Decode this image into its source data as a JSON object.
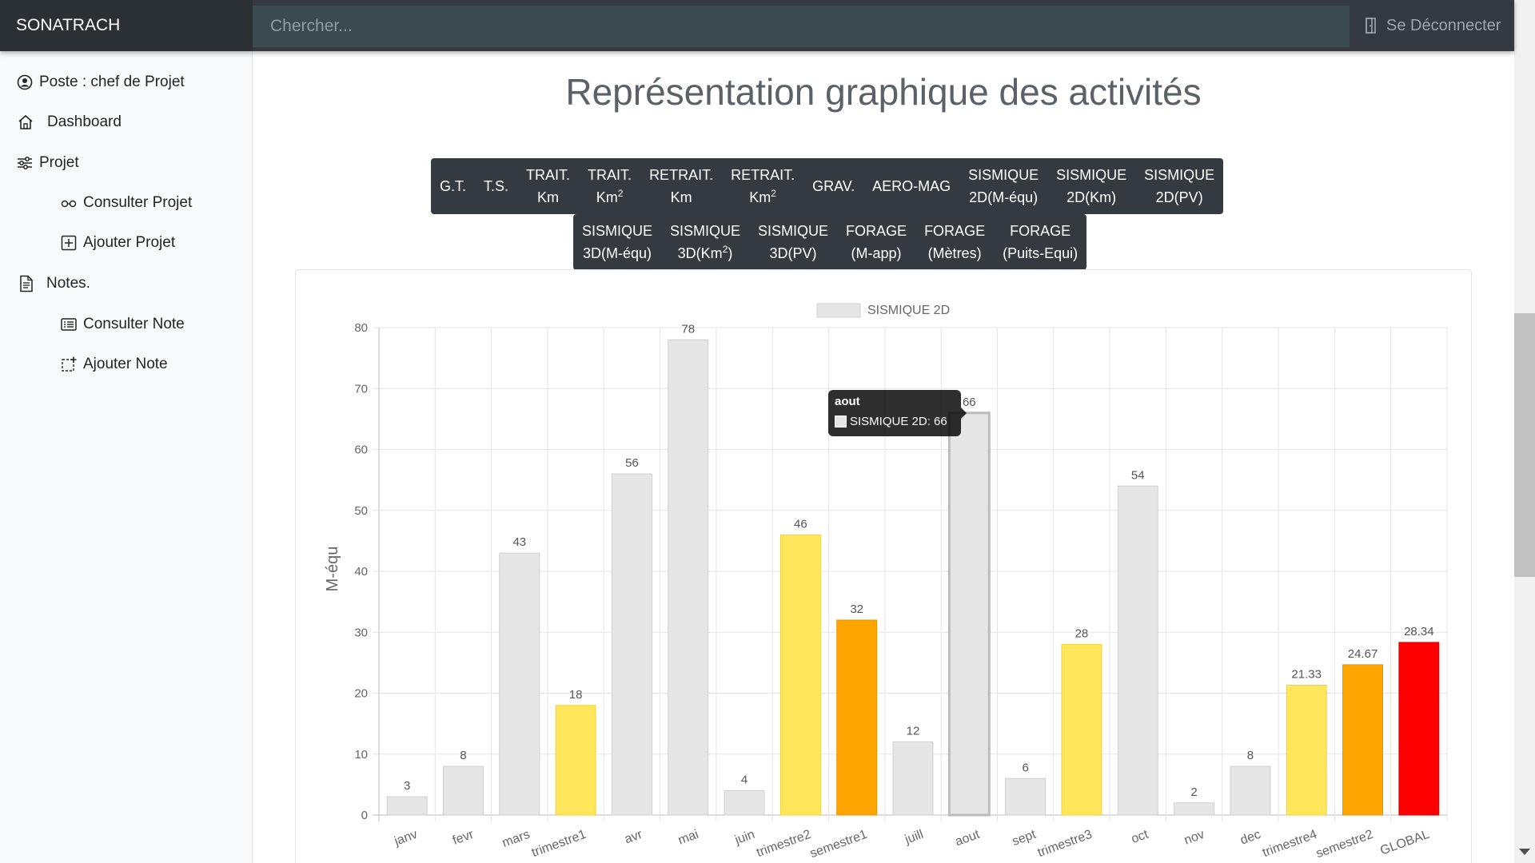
{
  "topbar": {
    "brand": "SONATRACH",
    "search_placeholder": "Chercher...",
    "logout_label": "Se Déconnecter"
  },
  "sidebar": {
    "poste": "Poste : chef de Projet",
    "dashboard": "Dashboard",
    "projet": "Projet",
    "consulter_projet": "Consulter Projet",
    "ajouter_projet": "Ajouter Projet",
    "notes": "Notes.",
    "consulter_note": "Consulter Note",
    "ajouter_note": "Ajouter Note"
  },
  "page": {
    "title": "Représentation graphique des activités"
  },
  "activity_buttons_row1": [
    {
      "l1": "G.T.",
      "l2": ""
    },
    {
      "l1": "T.S.",
      "l2": ""
    },
    {
      "l1": "TRAIT.",
      "l2": "Km"
    },
    {
      "l1": "TRAIT.",
      "l2": "Km",
      "sup": "2"
    },
    {
      "l1": "RETRAIT.",
      "l2": "Km"
    },
    {
      "l1": "RETRAIT.",
      "l2": "Km",
      "sup": "2"
    },
    {
      "l1": "GRAV.",
      "l2": ""
    },
    {
      "l1": "AERO-MAG",
      "l2": ""
    },
    {
      "l1": "SISMIQUE",
      "l2": "2D(M-équ)"
    },
    {
      "l1": "SISMIQUE",
      "l2": "2D(Km)"
    },
    {
      "l1": "SISMIQUE",
      "l2": "2D(PV)"
    }
  ],
  "activity_buttons_row2": [
    {
      "l1": "SISMIQUE",
      "l2": "3D(M-équ)"
    },
    {
      "l1": "SISMIQUE",
      "l2": "3D(Km",
      "sup": "2",
      "l2_after": ")"
    },
    {
      "l1": "SISMIQUE",
      "l2": "3D(PV)"
    },
    {
      "l1": "FORAGE",
      "l2": "(M-app)"
    },
    {
      "l1": "FORAGE",
      "l2": "(Mètres)"
    },
    {
      "l1": "FORAGE",
      "l2": "(Puits-Equi)"
    }
  ],
  "tooltip": {
    "title": "aout",
    "text": "SISMIQUE 2D: 66"
  },
  "colors": {
    "month": "#e6e6e6",
    "trimestre": "#ffe65a",
    "semestre": "#ffa500",
    "global": "#ff0000"
  },
  "chart_data": {
    "type": "bar",
    "legend": "SISMIQUE 2D",
    "ylabel": "M-équ",
    "ylim": [
      0,
      80
    ],
    "yticks": [
      0,
      10,
      20,
      30,
      40,
      50,
      60,
      70,
      80
    ],
    "categories": [
      "janv",
      "fevr",
      "mars",
      "trimestre1",
      "avr",
      "mai",
      "juin",
      "trimestre2",
      "semestre1",
      "juill",
      "aout",
      "sept",
      "trimestre3",
      "oct",
      "nov",
      "dec",
      "trimestre4",
      "semestre2",
      "GLOBAL"
    ],
    "values": [
      3,
      8,
      43,
      18,
      56,
      78,
      4,
      46,
      32,
      12,
      66,
      6,
      28,
      54,
      2,
      8,
      21.33,
      24.67,
      28.34
    ],
    "value_labels": [
      "3",
      "8",
      "43",
      "18",
      "56",
      "78",
      "4",
      "46",
      "32",
      "12",
      "66",
      "6",
      "28",
      "54",
      "2",
      "8",
      "21.33",
      "24.67",
      "28.34"
    ],
    "kinds": [
      "month",
      "month",
      "month",
      "trimestre",
      "month",
      "month",
      "month",
      "trimestre",
      "semestre",
      "month",
      "month",
      "month",
      "trimestre",
      "month",
      "month",
      "month",
      "trimestre",
      "semestre",
      "global"
    ],
    "highlighted": "aout"
  }
}
